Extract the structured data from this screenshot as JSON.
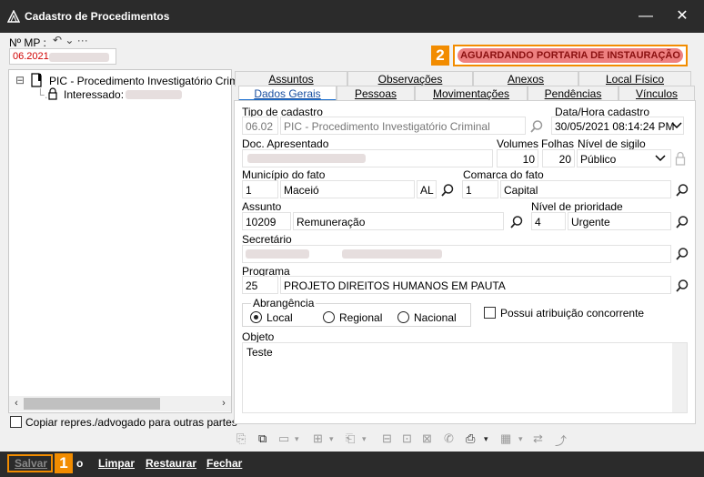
{
  "window": {
    "title": "Cadastro de Procedimentos",
    "minimize": "—",
    "close": "✕"
  },
  "header": {
    "mp_label": "Nº MP :",
    "mp_value": "06.2021",
    "undo_glyphs": "↶ ⌄ ···",
    "status_badge_number": "2",
    "status_text": "AGUARDANDO PORTARIA DE INSTAURAÇÃO"
  },
  "tree": {
    "root_label": "PIC - Procedimento Investigatório Crimi",
    "child_label": "Interessado:",
    "copy_checkbox_label": "Copiar repres./advogado para outras partes"
  },
  "tabs": {
    "row1": [
      "Assuntos",
      "Observações",
      "Anexos",
      "Local Físico"
    ],
    "row2": [
      "Dados Gerais",
      "Pessoas",
      "Movimentações",
      "Pendências",
      "Vínculos"
    ]
  },
  "form": {
    "tipo_label": "Tipo de cadastro",
    "tipo_code": "06.02",
    "tipo_value": "PIC - Procedimento Investigatório Criminal",
    "data_label": "Data/Hora cadastro",
    "data_value": "30/05/2021 08:14:24 PM",
    "doc_label": "Doc. Apresentado",
    "volumes_label": "Volumes",
    "volumes_value": "10",
    "folhas_label": "Folhas",
    "folhas_value": "20",
    "sigilo_label": "Nível de sigilo",
    "sigilo_value": "Público",
    "municipio_label": "Município do fato",
    "municipio_code": "1",
    "municipio_value": "Maceió",
    "municipio_uf": "AL",
    "comarca_label": "Comarca do fato",
    "comarca_code": "1",
    "comarca_value": "Capital",
    "assunto_label": "Assunto",
    "assunto_code": "10209",
    "assunto_value": "Remuneração",
    "prioridade_label": "Nível de prioridade",
    "prioridade_code": "4",
    "prioridade_value": "Urgente",
    "secretario_label": "Secretário",
    "programa_label": "Programa",
    "programa_code": "25",
    "programa_value": "PROJETO DIREITOS HUMANOS EM PAUTA",
    "abrangencia_label": "Abrangência",
    "radio_local": "Local",
    "radio_regional": "Regional",
    "radio_nacional": "Nacional",
    "concorrente_label": "Possui atribuição concorrente",
    "objeto_label": "Objeto",
    "objeto_value": "Teste"
  },
  "bottom": {
    "save_badge_number": "1",
    "save": "Salvar",
    "partial": "o",
    "limpar": "Limpar",
    "restaurar": "Restaurar",
    "fechar": "Fechar"
  },
  "colors": {
    "accent": "#f28c00",
    "status_bg": "#ee8080",
    "titlebar": "#2b2b2b",
    "tab_active": "#1a6fd0"
  }
}
